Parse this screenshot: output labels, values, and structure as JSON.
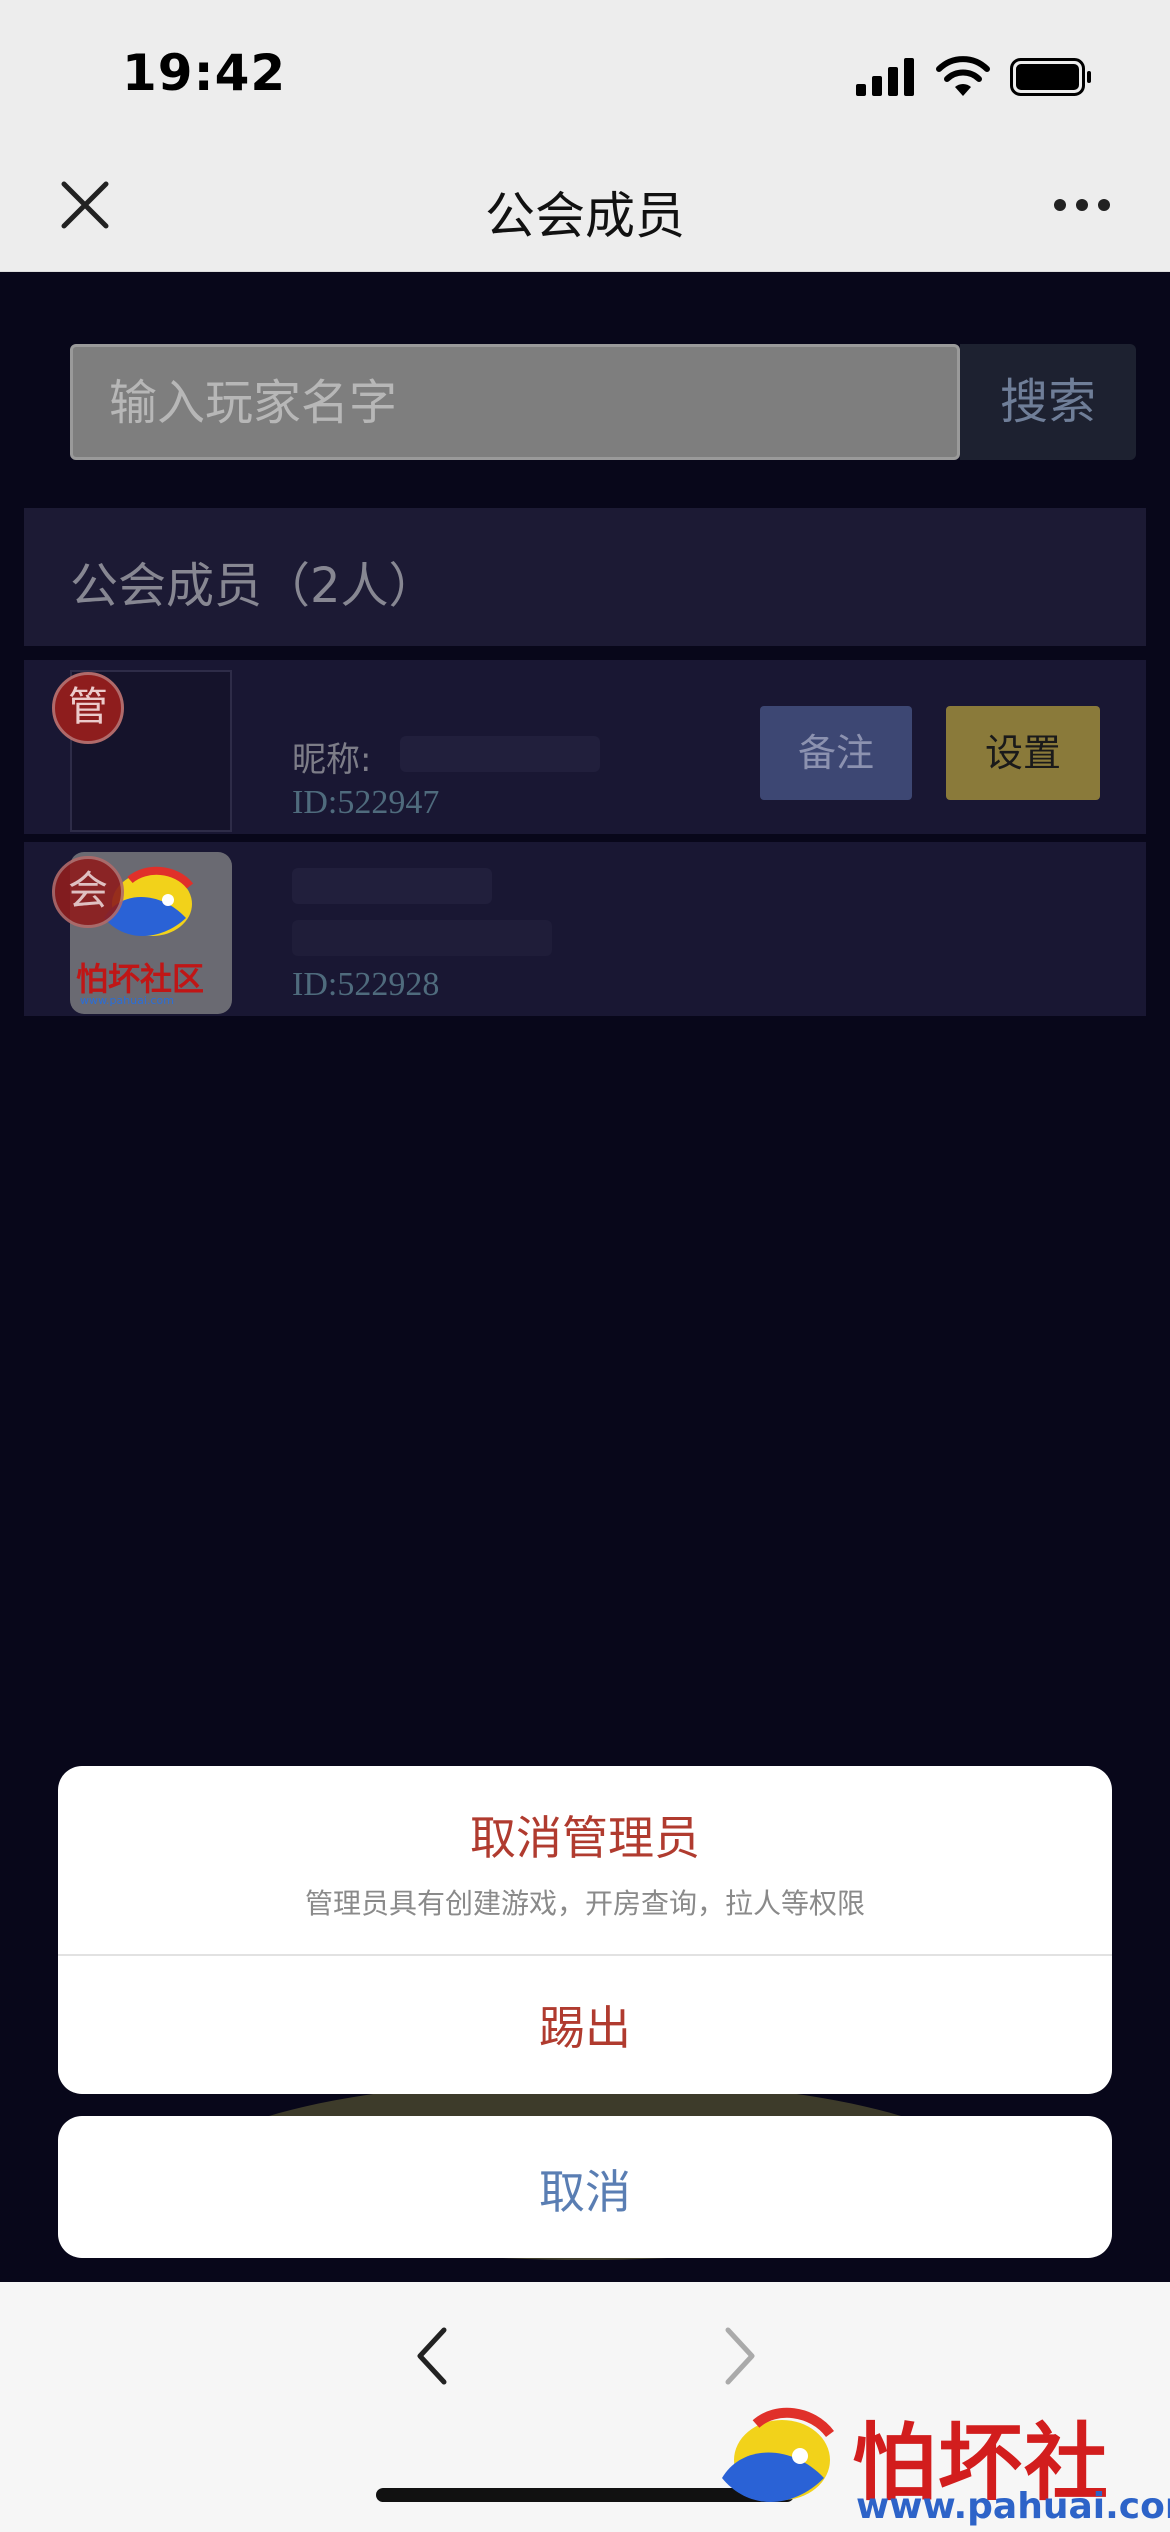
{
  "status_bar": {
    "time": "19:42"
  },
  "nav": {
    "title": "公会成员"
  },
  "search": {
    "placeholder": "输入玩家名字",
    "button_label": "搜索"
  },
  "section": {
    "title": "公会成员（2人）"
  },
  "members": [
    {
      "badge": "管",
      "nickname_label": "昵称:",
      "id": "ID:522947",
      "remark_label": "备注",
      "settings_label": "设置"
    },
    {
      "badge": "会",
      "id": "ID:522928",
      "avatar_text": "怕坏社区",
      "avatar_url": "www.pahuai.com"
    }
  ],
  "action_sheet": {
    "title": "取消管理员",
    "subtitle": "管理员具有创建游戏，开房查询，拉人等权限",
    "kick_label": "踢出",
    "cancel_label": "取消"
  },
  "watermark": {
    "text": "怕坏社区",
    "url": "www.pahuai.com"
  },
  "colors": {
    "background": "#08071a",
    "destructive": "#b03b2f",
    "cancel": "#5a7eb3",
    "settings_button": "#8a7a3a",
    "remark_button": "#3d4773"
  }
}
